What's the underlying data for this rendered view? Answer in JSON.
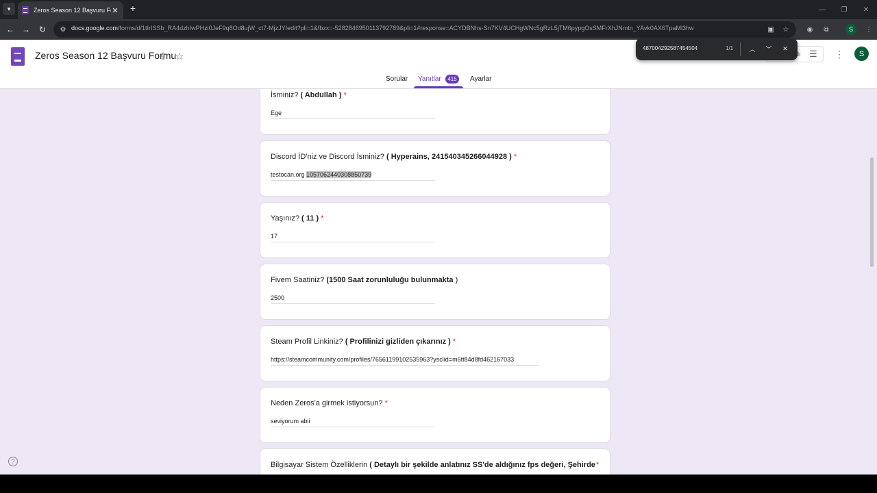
{
  "browser": {
    "tab_title": "Zeros Season 12 Başvuru Formu",
    "url_host": "docs.google.com",
    "url_path": "/forms/d/1tIrISSb_RA4dzhIwPHzi0JeF9q8Od8ujW_ct7-MjzJY/edit?pli=1&fbzx=-5282846950113792789&pli=1#response=ACYDBNhs-Sn7KV4UCHgWNc5gRzL5jTM6pypgOsSMFrXhJNmtn_YAvk0AX6TpaMl3hw"
  },
  "findbar": {
    "query": "487004292587454504",
    "count": "1/1"
  },
  "header": {
    "title": "Zeros Season 12 Başvuru Formu",
    "button_label": "dı",
    "avatar_letter": "S",
    "tabs": [
      {
        "label": "Sorular"
      },
      {
        "label": "Yanıtlar",
        "badge": "415"
      },
      {
        "label": "Ayarlar"
      }
    ]
  },
  "questions": [
    {
      "label": "İsminiz? ",
      "bold": "( Abdullah )",
      "required": "*",
      "answer": "Ege"
    },
    {
      "label": "Discord İD'niz ve Discord İsminiz?  ",
      "bold": "( Hyperains, 241540345266044928 )",
      "required": "*",
      "answer_pre": "testocan.org ",
      "answer_highlight": "1057062440308850739"
    },
    {
      "label": "Yaşınız? ",
      "bold": "( 11 )",
      "required": "*",
      "answer": "17"
    },
    {
      "label": "Fivem Saatiniz? ",
      "bold": "(1500 Saat zorunluluğu bulunmakta",
      "bold_tail": " )",
      "answer": "2500"
    },
    {
      "label": "Steam Profil Linkiniz? ",
      "bold": "( Profilinizi gizliden çıkarınız )",
      "required": "*",
      "answer": "https://steamcommunity.com/profiles/76561199102535963?ysclid=m6tt84d8fd462167033"
    },
    {
      "label": "Neden Zeros'a girmek istiyorsun?",
      "required": "*",
      "answer": "seviyorum abii"
    },
    {
      "label": "Bilgisayar Sistem Özelliklerin ",
      "bold": "( Detaylı bir şekilde anlatınız SS'de aldığınız fps değeri, Şehirde",
      "required": "*"
    }
  ],
  "colors": {
    "accent": "#673ab7",
    "page_bg": "#ede7f6",
    "required": "#d93025"
  },
  "icons": [
    "tab-list-icon",
    "forms-favicon",
    "close-icon",
    "plus-icon",
    "back-icon",
    "forward-icon",
    "reload-icon",
    "site-info-icon",
    "bookmark-star-icon",
    "extension-icon",
    "puzzle-icon",
    "add-to-drive-icon",
    "star-icon",
    "tune-icon",
    "more-vert-icon",
    "chevron-up-icon",
    "chevron-down-icon",
    "help-icon"
  ]
}
